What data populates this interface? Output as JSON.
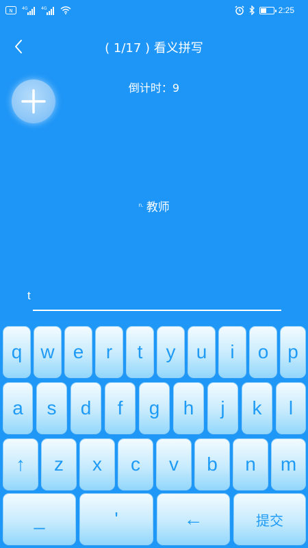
{
  "status_bar": {
    "left_icons": [
      "nfc-icon",
      "signal-4g-icon",
      "signal-4g-icon",
      "wifi-icon"
    ],
    "right_icons": [
      "alarm-icon",
      "bluetooth-icon",
      "battery-icon"
    ],
    "battery_level": 0.45,
    "time": "2:25"
  },
  "nav": {
    "back_icon": "chevron-left-icon",
    "title": "( 1/17 ) 看义拼写"
  },
  "fab": {
    "icon": "plus-icon"
  },
  "countdown": "倒计时：9",
  "word": {
    "pos": "n.",
    "meaning": "教师"
  },
  "answer": {
    "value": "t"
  },
  "keyboard": {
    "row1": [
      "q",
      "w",
      "e",
      "r",
      "t",
      "y",
      "u",
      "i",
      "o",
      "p"
    ],
    "row2": [
      "a",
      "s",
      "d",
      "f",
      "g",
      "h",
      "j",
      "k",
      "l"
    ],
    "row3": [
      "↑",
      "z",
      "x",
      "c",
      "v",
      "b",
      "n",
      "m"
    ],
    "row4": [
      "_",
      "'",
      "←",
      "提交"
    ]
  },
  "colors": {
    "background": "#1e96f7",
    "key_text": "#1f9bf5"
  }
}
